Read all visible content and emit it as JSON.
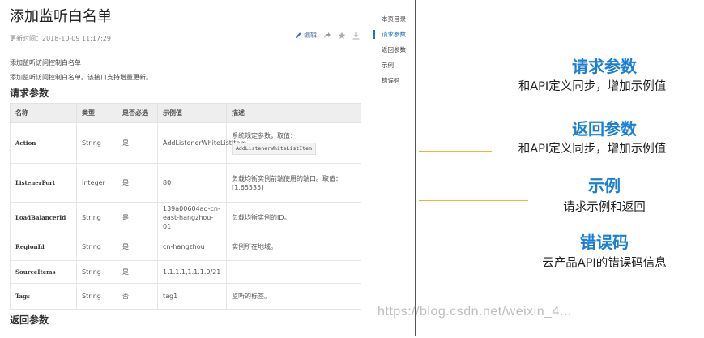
{
  "doc": {
    "title": "添加监听白名单",
    "updated": "更新时间：2018-10-09 11:17:29",
    "edit_label": "编辑",
    "intro_title": "添加监听访问控制白名单",
    "intro_desc": "添加监听访问控制白名单。该接口支持增量更新。",
    "request_heading": "请求参数",
    "return_heading": "返回参数"
  },
  "toc": {
    "items": [
      {
        "label": "本页目录",
        "active": false
      },
      {
        "label": "请求参数",
        "active": true
      },
      {
        "label": "返回参数",
        "active": false
      },
      {
        "label": "示例",
        "active": false
      },
      {
        "label": "错误码",
        "active": false
      }
    ]
  },
  "table": {
    "headers": [
      "名称",
      "类型",
      "是否必选",
      "示例值",
      "描述"
    ],
    "rows": [
      {
        "name": "Action",
        "type": "String",
        "required": "是",
        "example": "AddListenerWhiteListItem",
        "desc": "系统规定参数，取值：",
        "code": "AddListenerWhiteListItem"
      },
      {
        "name": "ListenerPort",
        "type": "Integer",
        "required": "是",
        "example": "80",
        "desc": "负载均衡实例前端使用的端口。取值：[1,65535]",
        "code": ""
      },
      {
        "name": "LoadBalancerId",
        "type": "String",
        "required": "是",
        "example": "139a00604ad-cn-east-hangzhou-01",
        "desc": "负载均衡实例的ID。",
        "code": ""
      },
      {
        "name": "RegionId",
        "type": "String",
        "required": "是",
        "example": "cn-hangzhou",
        "desc": "实例所在地域。",
        "code": ""
      },
      {
        "name": "SourceItems",
        "type": "String",
        "required": "是",
        "example": "1.1.1.1,1.1.1.0/21",
        "desc": "",
        "code": ""
      },
      {
        "name": "Tags",
        "type": "String",
        "required": "否",
        "example": "tag1",
        "desc": "监听的标签。",
        "code": ""
      }
    ]
  },
  "annotations": [
    {
      "title": "请求参数",
      "desc": "和API定义同步，增加示例值"
    },
    {
      "title": "返回参数",
      "desc": "和API定义同步，增加示例值"
    },
    {
      "title": "示例",
      "desc": "请求示例和返回"
    },
    {
      "title": "错误码",
      "desc": "云产品API的错误码信息"
    }
  ],
  "watermark": "https://blog.csdn.net/weixin_4..."
}
